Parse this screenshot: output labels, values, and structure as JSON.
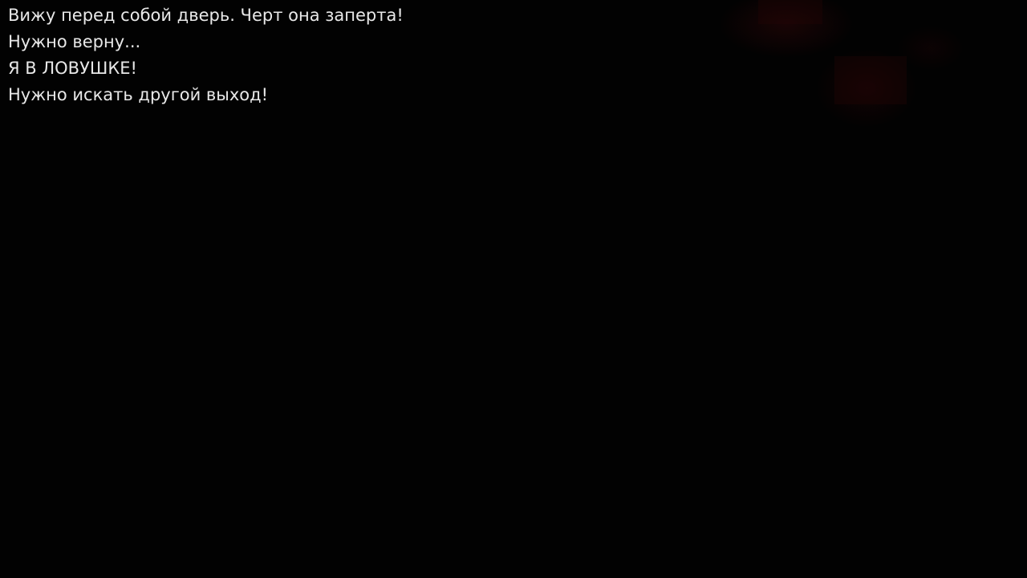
{
  "background": {
    "color": "#020202",
    "glow_color": "#2d0608"
  },
  "dialogue": {
    "text_color": "#e8e8e8",
    "lines": [
      "Вижу перед собой дверь. Черт она заперта!",
      "Нужно верну...",
      "Я В ЛОВУШКЕ!",
      "Нужно искать другой выход!"
    ]
  }
}
